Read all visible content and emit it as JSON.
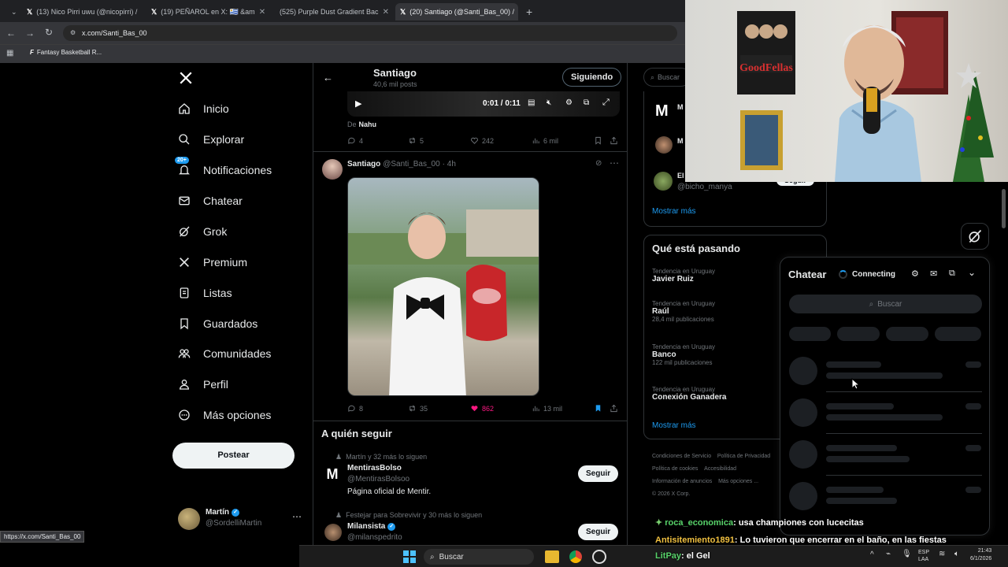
{
  "browser": {
    "tabs": [
      {
        "title": "(13) Nico Pirri uwu (@nicopirri) /",
        "active": false
      },
      {
        "title": "(19) PEÑAROL en X: 🇺🇾 &am",
        "active": false
      },
      {
        "title": "(525) Purple Dust Gradient Bac",
        "active": false
      },
      {
        "title": "(20) Santiago (@Santi_Bas_00) /",
        "active": true
      }
    ],
    "url": "x.com/Santi_Bas_00",
    "bookmark": "Fantasy Basketball R...",
    "status_url": "https://x.com/Santi_Bas_00"
  },
  "nav": {
    "items": [
      {
        "label": "Inicio",
        "icon": "home-icon"
      },
      {
        "label": "Explorar",
        "icon": "search-icon"
      },
      {
        "label": "Notificaciones",
        "icon": "bell-icon"
      },
      {
        "label": "Chatear",
        "icon": "mail-icon"
      },
      {
        "label": "Grok",
        "icon": "grok-icon"
      },
      {
        "label": "Premium",
        "icon": "x-logo-icon"
      },
      {
        "label": "Listas",
        "icon": "list-icon"
      },
      {
        "label": "Guardados",
        "icon": "bookmark-icon"
      },
      {
        "label": "Comunidades",
        "icon": "people-icon"
      },
      {
        "label": "Perfil",
        "icon": "person-icon"
      },
      {
        "label": "Más opciones",
        "icon": "more-circle-icon"
      }
    ],
    "notif_badge": "20+",
    "post_label": "Postear",
    "account": {
      "name": "Martín",
      "handle": "@SordelliMartin"
    }
  },
  "profile_header": {
    "name": "Santiago",
    "posts": "40,6 mil posts",
    "follow_label": "Siguiendo"
  },
  "video": {
    "time": "0:01 / 0:11",
    "from_label": "De",
    "from_name": "Nahu"
  },
  "post1_stats": {
    "replies": "4",
    "reposts": "5",
    "likes": "242",
    "views": "6 mil"
  },
  "post2": {
    "name": "Santiago",
    "handle": "@Santi_Bas_00",
    "time": "· 4h",
    "stats": {
      "replies": "8",
      "reposts": "35",
      "likes": "862",
      "views": "13 mil"
    }
  },
  "who_to_follow": {
    "title": "A quién seguir",
    "accounts": [
      {
        "context": "Martín y 32 más lo siguen",
        "name": "MentirasBolso",
        "handle": "@MentirasBolsoo",
        "bio": "Página oficial de Mentir.",
        "button": "Seguir"
      },
      {
        "context": "Festejar para Sobrevivir y 30 más lo siguen",
        "name": "Milansista",
        "handle": "@milanspedrito",
        "button": "Seguir"
      }
    ]
  },
  "right": {
    "search_placeholder": "Buscar",
    "suggest_fragment": {
      "name": "El",
      "handle": "@bicho_manya",
      "button": "Seguir"
    },
    "show_more": "Mostrar más",
    "trends_title": "Qué está pasando",
    "trends": [
      {
        "category": "Tendencia en Uruguay",
        "name": "Javier Ruiz",
        "count": ""
      },
      {
        "category": "Tendencia en Uruguay",
        "name": "Raúl",
        "count": "28,4 mil publicaciones"
      },
      {
        "category": "Tendencia en Uruguay",
        "name": "Banco",
        "count": "122 mil publicaciones"
      },
      {
        "category": "Tendencia en Uruguay",
        "name": "Conexión Ganadera",
        "count": ""
      }
    ],
    "show_more2": "Mostrar más",
    "footer": [
      "Condiciones de Servicio",
      "Política de Privacidad",
      "Política de cookies",
      "Accesibilidad",
      "Información de anuncios",
      "Más opciones ...",
      "© 2026 X Corp."
    ]
  },
  "chat": {
    "title": "Chatear",
    "status": "Connecting",
    "search_placeholder": "Buscar"
  },
  "stream_chat": [
    {
      "user": "roca_economica",
      "msg": ": usa championes con lucecitas",
      "color": "#58d36a"
    },
    {
      "user": "Antisitemiento1891",
      "msg": ": Lo tuvieron que encerrar en el baño, en las fiestas",
      "color": "#f0c040"
    },
    {
      "user": "LitPay",
      "msg": ": el Gel",
      "color": "#58d36a"
    }
  ],
  "taskbar": {
    "search": "Buscar",
    "lang": "ESP\nLAA",
    "time": "21:43",
    "date": "6/1/2026"
  },
  "colors": {
    "accent": "#1d9bf0",
    "like": "#f91880",
    "background": "#000000"
  }
}
